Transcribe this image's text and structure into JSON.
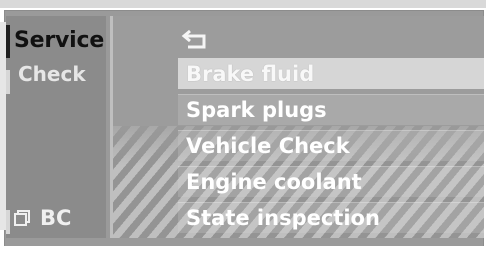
{
  "left": {
    "title": "Service",
    "subtitle": "Check",
    "bottom_label": "BC"
  },
  "right": {
    "items": [
      {
        "label": "Brake fluid",
        "selected": true
      },
      {
        "label": "Spark plugs",
        "selected": false
      },
      {
        "label": "Vehicle Check",
        "selected": false
      },
      {
        "label": "Engine coolant",
        "selected": false
      },
      {
        "label": "State inspection",
        "selected": false
      }
    ]
  },
  "icons": {
    "back": "back-arrow-icon",
    "bc": "bc-copy-icon"
  }
}
